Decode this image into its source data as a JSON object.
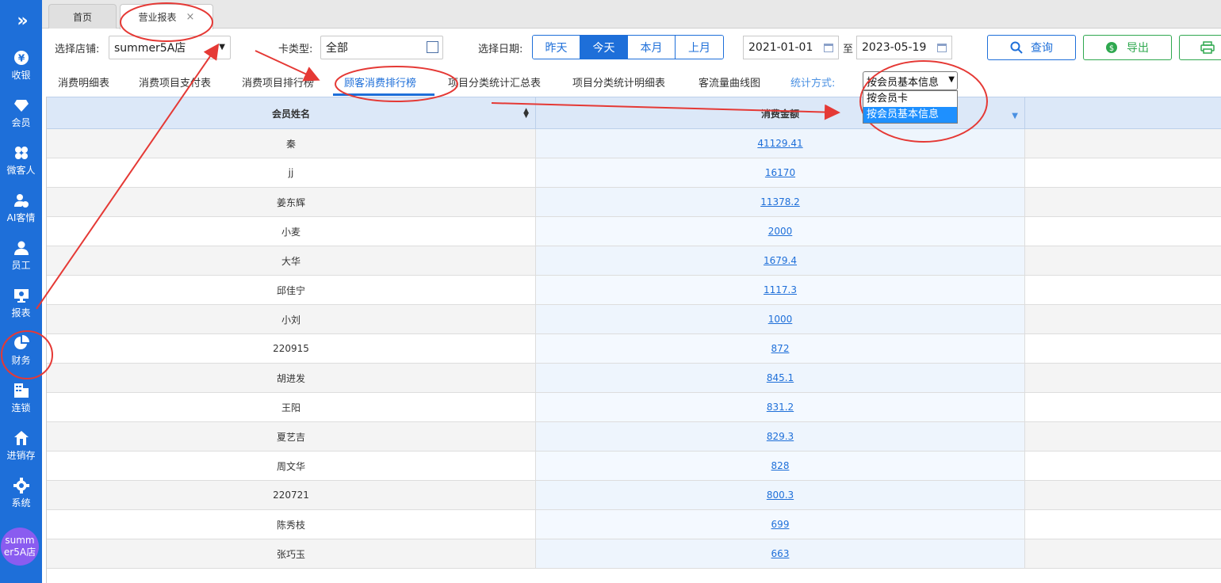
{
  "sidebar": {
    "toggle": "»",
    "items": [
      {
        "label": "收银",
        "icon": "yen-icon"
      },
      {
        "label": "会员",
        "icon": "diamond-icon"
      },
      {
        "label": "微客人",
        "icon": "clover-icon"
      },
      {
        "label": "AI客情",
        "icon": "user-heart-icon"
      },
      {
        "label": "员工",
        "icon": "user-icon"
      },
      {
        "label": "报表",
        "icon": "monitor-chart-icon"
      },
      {
        "label": "财务",
        "icon": "pie-chart-icon"
      },
      {
        "label": "连锁",
        "icon": "building-icon"
      },
      {
        "label": "进销存",
        "icon": "home-store-icon"
      },
      {
        "label": "系统",
        "icon": "gear-icon"
      }
    ],
    "avatar": "summer5A店"
  },
  "tabs": [
    {
      "label": "首页",
      "closable": false
    },
    {
      "label": "营业报表",
      "closable": true,
      "close": "×"
    }
  ],
  "filters": {
    "store_label": "选择店铺:",
    "store_value": "summer5A店",
    "card_type_label": "卡类型:",
    "card_type_value": "全部",
    "date_label": "选择日期:",
    "quick_dates": [
      "昨天",
      "今天",
      "本月",
      "上月"
    ],
    "active_quick_date": "今天",
    "date_from": "2021-01-01",
    "date_sep": "至",
    "date_to": "2023-05-19",
    "query_button": "查询",
    "export_button": "导出"
  },
  "report_tabs": [
    "消费明细表",
    "消费项目支付表",
    "消费项目排行榜",
    "顾客消费排行榜",
    "项目分类统计汇总表",
    "项目分类统计明细表",
    "客流量曲线图"
  ],
  "active_report_tab": "顾客消费排行榜",
  "stat_mode": {
    "label": "统计方式:",
    "value": "按会员基本信息",
    "options": [
      "按会员卡",
      "按会员基本信息"
    ],
    "highlighted": "按会员基本信息"
  },
  "table": {
    "columns": [
      "会员姓名",
      "消费金额"
    ],
    "rows": [
      {
        "name": "秦",
        "amount": "41129.41"
      },
      {
        "name": "jj",
        "amount": "16170"
      },
      {
        "name": "姜东辉",
        "amount": "11378.2"
      },
      {
        "name": "小麦",
        "amount": "2000"
      },
      {
        "name": "大华",
        "amount": "1679.4"
      },
      {
        "name": "邱佳宁",
        "amount": "1117.3"
      },
      {
        "name": "小刘",
        "amount": "1000"
      },
      {
        "name": "220915",
        "amount": "872"
      },
      {
        "name": "胡进发",
        "amount": "845.1"
      },
      {
        "name": "王阳",
        "amount": "831.2"
      },
      {
        "name": "夏艺吉",
        "amount": "829.3"
      },
      {
        "name": "周文华",
        "amount": "828"
      },
      {
        "name": "220721",
        "amount": "800.3"
      },
      {
        "name": "陈秀枝",
        "amount": "699"
      },
      {
        "name": "张巧玉",
        "amount": "663"
      }
    ]
  },
  "colors": {
    "primary": "#1e6fd9",
    "export_green": "#2fa84f",
    "annotation_red": "#e53935",
    "avatar": "#8a5cf0"
  }
}
